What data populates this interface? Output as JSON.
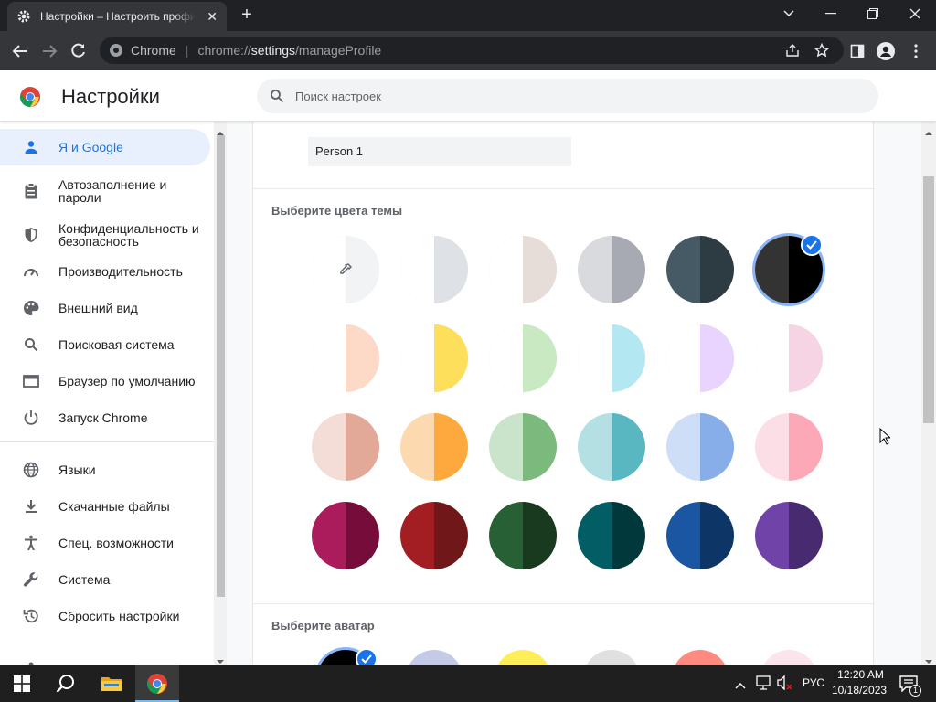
{
  "browser": {
    "tab_title": "Настройки – Настроить профиль",
    "tab_close": "✕",
    "new_tab": "+",
    "site_label": "Chrome",
    "url_scheme": "chrome://",
    "url_host": "settings",
    "url_path": "/manageProfile"
  },
  "settings": {
    "title": "Настройки",
    "search_placeholder": "Поиск настроек"
  },
  "sidebar": {
    "items": [
      {
        "label": "Я и Google",
        "icon": "person-icon",
        "active": true
      },
      {
        "label": "Автозаполнение и пароли",
        "icon": "clipboard-icon"
      },
      {
        "label": "Конфиденциальность и безопасность",
        "icon": "shield-icon"
      },
      {
        "label": "Производительность",
        "icon": "gauge-icon"
      },
      {
        "label": "Внешний вид",
        "icon": "palette-icon"
      },
      {
        "label": "Поисковая система",
        "icon": "search-icon"
      },
      {
        "label": "Браузер по умолчанию",
        "icon": "browser-icon"
      },
      {
        "label": "Запуск Chrome",
        "icon": "power-icon"
      },
      {
        "label": "Языки",
        "icon": "globe-icon"
      },
      {
        "label": "Скачанные файлы",
        "icon": "download-icon"
      },
      {
        "label": "Спец. возможности",
        "icon": "accessibility-icon"
      },
      {
        "label": "Система",
        "icon": "wrench-icon"
      },
      {
        "label": "Сбросить настройки",
        "icon": "history-icon"
      }
    ]
  },
  "profile": {
    "name_value": "Person 1",
    "theme_label": "Выберите цвета темы",
    "avatar_label": "Выберите аватар",
    "theme_colors": [
      [
        [
          "#ffffff",
          "#f1f3f4"
        ],
        [
          "#ffffff",
          "#dee1e6"
        ],
        [
          "#ffffff",
          "#e6dcd8"
        ],
        [
          "#d8dadd",
          "#a7aab3"
        ],
        [
          "#455a64",
          "#2d3b42"
        ],
        [
          "#333333",
          "#000000"
        ]
      ],
      [
        [
          "#ffffff",
          "#fcdac7"
        ],
        [
          "#ffffff",
          "#fedf5c"
        ],
        [
          "#ffffff",
          "#c9e9c3"
        ],
        [
          "#ffffff",
          "#b3e8f3"
        ],
        [
          "#ffffff",
          "#e8d4fe"
        ],
        [
          "#ffffff",
          "#f6d4e3"
        ]
      ],
      [
        [
          "#f4ddd6",
          "#e2a999"
        ],
        [
          "#fcd9af",
          "#fda93d"
        ],
        [
          "#c9e4cb",
          "#7bba7c"
        ],
        [
          "#b5e0e3",
          "#59b7c1"
        ],
        [
          "#cfdef7",
          "#87aee8"
        ],
        [
          "#fcdfe6",
          "#fda8b7"
        ]
      ],
      [
        [
          "#aa1c5b",
          "#750c3a"
        ],
        [
          "#a21e23",
          "#6f1719"
        ],
        [
          "#276034",
          "#1a3a1f"
        ],
        [
          "#025e64",
          "#00383c"
        ],
        [
          "#1a56a1",
          "#0d3566"
        ],
        [
          "#6f43a7",
          "#482a70"
        ]
      ]
    ],
    "selected_theme": "6",
    "avatar_colors": [
      "#000000",
      "#c5cae9",
      "#ffee58",
      "#e0e0e0",
      "#ff8a80",
      "#fce4ec"
    ]
  },
  "taskbar": {
    "lang": "РУС",
    "time": "12:20 AM",
    "date": "10/18/2023",
    "notif_count": "1"
  }
}
